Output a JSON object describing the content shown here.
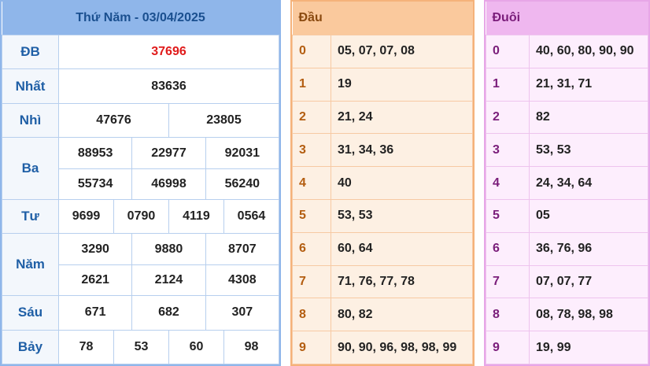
{
  "results": {
    "title": "Thứ Năm - 03/04/2025",
    "db": {
      "label": "ĐB",
      "value": "37696"
    },
    "nhat": {
      "label": "Nhất",
      "value": "83636"
    },
    "nhi": {
      "label": "Nhì",
      "values": [
        "47676",
        "23805"
      ]
    },
    "ba": {
      "label": "Ba",
      "values": [
        "88953",
        "22977",
        "92031",
        "55734",
        "46998",
        "56240"
      ]
    },
    "tu": {
      "label": "Tư",
      "values": [
        "9699",
        "0790",
        "4119",
        "0564"
      ]
    },
    "nam": {
      "label": "Năm",
      "values": [
        "3290",
        "9880",
        "8707",
        "2621",
        "2124",
        "4308"
      ]
    },
    "sau": {
      "label": "Sáu",
      "values": [
        "671",
        "682",
        "307"
      ]
    },
    "bay": {
      "label": "Bảy",
      "values": [
        "78",
        "53",
        "60",
        "98"
      ]
    }
  },
  "dau": {
    "header": "Đầu",
    "rows": [
      {
        "key": "0",
        "value": "05, 07, 07, 08"
      },
      {
        "key": "1",
        "value": "19"
      },
      {
        "key": "2",
        "value": "21, 24"
      },
      {
        "key": "3",
        "value": "31, 34, 36"
      },
      {
        "key": "4",
        "value": "40"
      },
      {
        "key": "5",
        "value": "53, 53"
      },
      {
        "key": "6",
        "value": "60, 64"
      },
      {
        "key": "7",
        "value": "71, 76, 77, 78"
      },
      {
        "key": "8",
        "value": "80, 82"
      },
      {
        "key": "9",
        "value": "90, 90, 96, 98, 98, 99"
      }
    ]
  },
  "duoi": {
    "header": "Đuôi",
    "rows": [
      {
        "key": "0",
        "value": "40, 60, 80, 90, 90"
      },
      {
        "key": "1",
        "value": "21, 31, 71"
      },
      {
        "key": "2",
        "value": "82"
      },
      {
        "key": "3",
        "value": "53, 53"
      },
      {
        "key": "4",
        "value": "24, 34, 64"
      },
      {
        "key": "5",
        "value": "05"
      },
      {
        "key": "6",
        "value": "36, 76, 96"
      },
      {
        "key": "7",
        "value": "07, 07, 77"
      },
      {
        "key": "8",
        "value": "08, 78, 98, 98"
      },
      {
        "key": "9",
        "value": "19, 99"
      }
    ]
  }
}
